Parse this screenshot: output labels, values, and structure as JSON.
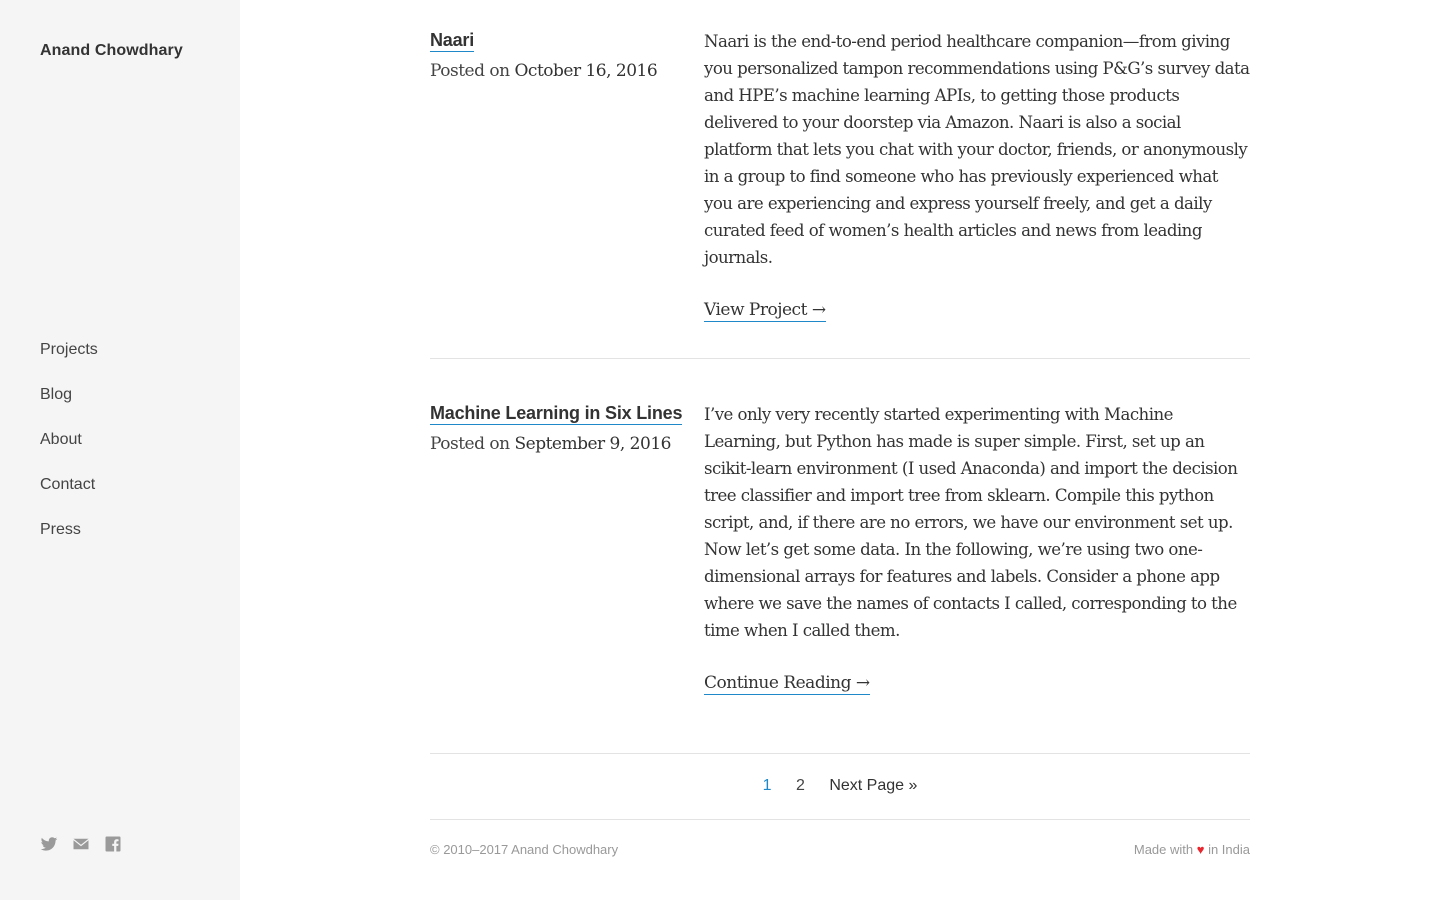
{
  "sidebar": {
    "site_title": "Anand Chowdhary",
    "nav": [
      "Projects",
      "Blog",
      "About",
      "Contact",
      "Press"
    ],
    "social_icons": [
      "twitter-icon",
      "mail-icon",
      "facebook-icon"
    ]
  },
  "posts": [
    {
      "title": "Naari",
      "date_label": "Posted on",
      "date": "October 16, 2016",
      "excerpt": "Naari is the end-to-end period healthcare companion—from giving you personalized tampon recommendations using P&G’s survey data and HPE’s machine learning APIs, to getting those products delivered to your doorstep via Amazon. Naari is also a social platform that lets you chat with your doctor, friends, or anonymously in a group to find someone who has previously experienced what you are experiencing and express yourself freely, and get a daily curated feed of women’s health articles and news from leading journals.",
      "link": "View Project →"
    },
    {
      "title": "Machine Learning in Six Lines",
      "date_label": "Posted on",
      "date": "September 9, 2016",
      "excerpt": "I’ve only very recently started experimenting with Machine Learning, but Python has made is super simple. First, set up an scikit-learn environment (I used Anaconda) and import the decision tree classifier and import tree from sklearn. Compile this python script, and, if there are no errors, we have our environment set up. Now let’s get some data. In the following, we’re using two one-dimensional arrays for features and labels. Consider a phone app where we save the names of contacts I called, corresponding to the time when I called them.",
      "link": "Continue Reading →"
    }
  ],
  "pagination": {
    "current": "1",
    "page2": "2",
    "next": "Next Page »"
  },
  "footer": {
    "copyright": "© 2010–2017 Anand Chowdhary",
    "made_prefix": "Made with",
    "heart": "♥",
    "made_suffix": "in India"
  },
  "colors": {
    "accent": "#1e88c8",
    "sidebar_bg": "#f5f5f5",
    "heart": "#e8262e"
  }
}
